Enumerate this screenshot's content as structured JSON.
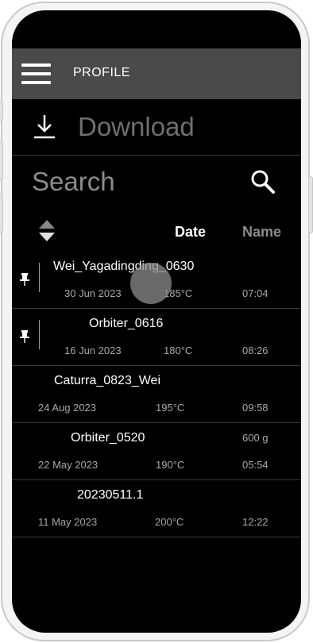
{
  "header": {
    "title": "PROFILE"
  },
  "download": {
    "label": "Download"
  },
  "search": {
    "label": "Search"
  },
  "columns": {
    "date": "Date",
    "name": "Name"
  },
  "rows": [
    {
      "name": "Wei_Yagadingding_0630",
      "date": "30 Jun 2023",
      "temp": "185°C",
      "time": "07:04",
      "pinned": true
    },
    {
      "name": "Orbiter_0616",
      "date": "16 Jun 2023",
      "temp": "180°C",
      "time": "08:26",
      "pinned": true
    },
    {
      "name": "Caturra_0823_Wei",
      "date": "24 Aug 2023",
      "temp": "195°C",
      "time": "09:58",
      "pinned": false
    },
    {
      "name": "Orbiter_0520",
      "weight": "600 g",
      "date": "22 May 2023",
      "temp": "190°C",
      "time": "05:54",
      "pinned": false
    },
    {
      "name": "20230511.1",
      "date": "11 May 2023",
      "temp": "200°C",
      "time": "12:22",
      "pinned": false
    }
  ],
  "colors": {
    "screen": "#000000",
    "header": "#4a4a4a",
    "divider": "#3a3a3a"
  },
  "icons": [
    "menu-icon",
    "download-icon",
    "search-icon",
    "sort-icon",
    "pin-icon"
  ]
}
